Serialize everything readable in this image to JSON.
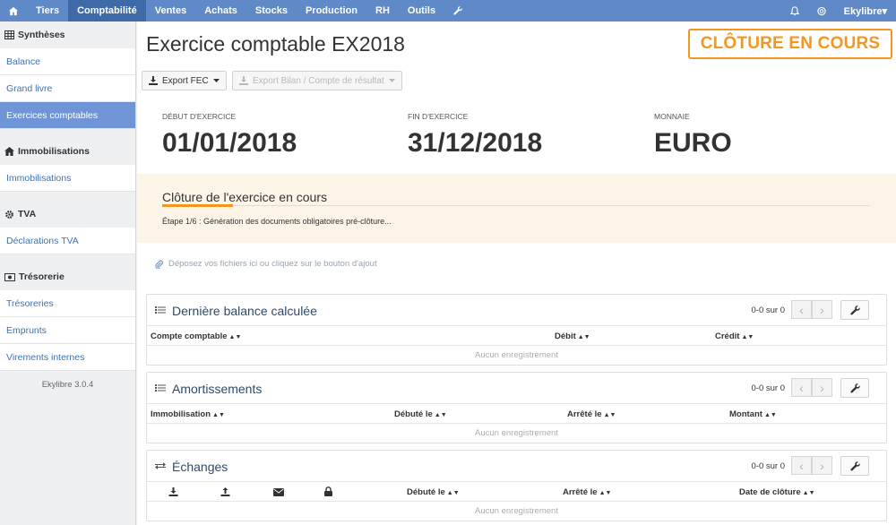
{
  "nav": {
    "items": [
      {
        "label": "Tiers",
        "active": false
      },
      {
        "label": "Comptabilité",
        "active": true
      },
      {
        "label": "Ventes",
        "active": false
      },
      {
        "label": "Achats",
        "active": false
      },
      {
        "label": "Stocks",
        "active": false
      },
      {
        "label": "Production",
        "active": false
      },
      {
        "label": "RH",
        "active": false
      },
      {
        "label": "Outils",
        "active": false
      }
    ],
    "user": "Ekylibre▾"
  },
  "sidebar": {
    "sections": [
      {
        "title": "Synthèses",
        "icon": "table-icon",
        "items": [
          {
            "label": "Balance"
          },
          {
            "label": "Grand livre"
          },
          {
            "label": "Exercices comptables",
            "active": true
          }
        ]
      },
      {
        "title": "Immobilisations",
        "icon": "home-icon",
        "items": [
          {
            "label": "Immobilisations"
          }
        ]
      },
      {
        "title": "TVA",
        "icon": "gear-icon",
        "items": [
          {
            "label": "Déclarations TVA"
          }
        ]
      },
      {
        "title": "Trésorerie",
        "icon": "money-icon",
        "items": [
          {
            "label": "Trésoreries"
          },
          {
            "label": "Emprunts"
          },
          {
            "label": "Virements internes"
          }
        ]
      }
    ],
    "version": "Ekylibre 3.0.4"
  },
  "page": {
    "title": "Exercice comptable EX2018",
    "status": "CLÔTURE EN COURS",
    "export_fec": "Export FEC",
    "export_bilan": "Export Bilan / Compte de résultat"
  },
  "stats": {
    "start_label": "DÉBUT D'EXERCICE",
    "start_value": "01/01/2018",
    "end_label": "FIN D'EXERCICE",
    "end_value": "31/12/2018",
    "currency_label": "MONNAIE",
    "currency_value": "EURO"
  },
  "closure": {
    "title": "Clôture de l'exercice en cours",
    "step": "Étape 1/6 : Génération des documents obligatoires pré-clôture...",
    "progress": 0.1
  },
  "dropzone": "Déposez vos fichiers ici ou cliquez sur le bouton d'ajout",
  "panels": [
    {
      "title": "Dernière balance calculée",
      "icon": "list-icon",
      "count": "0-0 sur 0",
      "columns": [
        "Compte comptable",
        "Débit",
        "Crédit"
      ],
      "empty": "Aucun enregistrement"
    },
    {
      "title": "Amortissements",
      "icon": "list-icon",
      "count": "0-0 sur 0",
      "columns": [
        "Immobilisation",
        "Débuté le",
        "Arrêté le",
        "Montant"
      ],
      "empty": "Aucun enregistrement"
    },
    {
      "title": "Échanges",
      "icon": "exchange-icon",
      "count": "0-0 sur 0",
      "columns": [
        "Débuté le",
        "Arrêté le",
        "Date de clôture"
      ],
      "empty": "Aucun enregistrement"
    }
  ],
  "colors": {
    "accent": "#5f8ac7",
    "active_nav": "#3e6aa8",
    "status": "#f5961e",
    "closure_bg": "#fcf4e6"
  }
}
